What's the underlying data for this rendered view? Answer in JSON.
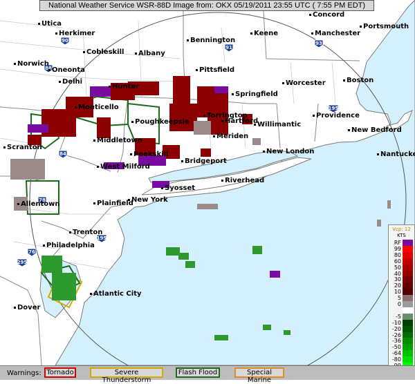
{
  "header": {
    "title": "National Weather Service WSR-88D Image from: OKX 05/19/2011 23:55 UTC ( 7:55 PM EDT)"
  },
  "cities": [
    {
      "name": "Utica",
      "dot": true
    },
    {
      "name": "Herkimer",
      "dot": true
    },
    {
      "name": "Bennington",
      "dot": true
    },
    {
      "name": "Keene",
      "dot": true
    },
    {
      "name": "Concord",
      "dot": true
    },
    {
      "name": "Manchester",
      "dot": true
    },
    {
      "name": "Portsmouth",
      "dot": true
    },
    {
      "name": "Cobleskill",
      "dot": true
    },
    {
      "name": "Albany",
      "dot": true
    },
    {
      "name": "Norwich",
      "dot": true
    },
    {
      "name": "Oneonta",
      "dot": true
    },
    {
      "name": "Delhi",
      "dot": true
    },
    {
      "name": "Pittsfield",
      "dot": true
    },
    {
      "name": "Worcester",
      "dot": true
    },
    {
      "name": "Boston",
      "dot": true
    },
    {
      "name": "Hunter",
      "dot": true
    },
    {
      "name": "Springfield",
      "dot": true
    },
    {
      "name": "Monticello",
      "dot": true
    },
    {
      "name": "Poughkeepsie",
      "dot": true
    },
    {
      "name": "Torrington",
      "dot": true
    },
    {
      "name": "Hartford",
      "dot": true
    },
    {
      "name": "Willimantic",
      "dot": true
    },
    {
      "name": "Providence",
      "dot": true
    },
    {
      "name": "New Bedford",
      "dot": true
    },
    {
      "name": "Scranton",
      "dot": true
    },
    {
      "name": "Middletown",
      "dot": true
    },
    {
      "name": "Meriden",
      "dot": true
    },
    {
      "name": "Nantucket",
      "dot": true
    },
    {
      "name": "Peekskill",
      "dot": true
    },
    {
      "name": "New London",
      "dot": true
    },
    {
      "name": "West Milford",
      "dot": true
    },
    {
      "name": "Bridgeport",
      "dot": true
    },
    {
      "name": "Riverhead",
      "dot": true
    },
    {
      "name": "Syosset",
      "dot": true
    },
    {
      "name": "Allentown",
      "dot": true
    },
    {
      "name": "Plainfield",
      "dot": true
    },
    {
      "name": "New York",
      "dot": true
    },
    {
      "name": "Trenton",
      "dot": true
    },
    {
      "name": "Philadelphia",
      "dot": true
    },
    {
      "name": "Atlantic City",
      "dot": true
    },
    {
      "name": "Dover",
      "dot": true
    }
  ],
  "highways": [
    "90",
    "88",
    "91",
    "95",
    "84",
    "87",
    "81",
    "78",
    "195",
    "76",
    "295",
    "495"
  ],
  "legend": {
    "vcp": "Vcp: 12",
    "units": "KTS",
    "entries": [
      {
        "label": "RF",
        "color": "#7a0ba0"
      },
      {
        "label": "99",
        "color": "#ff0000"
      },
      {
        "label": "80",
        "color": "#e00000"
      },
      {
        "label": "60",
        "color": "#c00000"
      },
      {
        "label": "50",
        "color": "#a80000"
      },
      {
        "label": "40",
        "color": "#900000"
      },
      {
        "label": "30",
        "color": "#780000"
      },
      {
        "label": "20",
        "color": "#640000"
      },
      {
        "label": "10",
        "color": "#500000"
      },
      {
        "label": "5",
        "color": "#8c6e6e"
      },
      {
        "label": "0",
        "color": "#9a9a9a"
      },
      {
        "label": "",
        "color": "#ffffff"
      },
      {
        "label": "-5",
        "color": "#6e8c6e"
      },
      {
        "label": "-10",
        "color": "#004000"
      },
      {
        "label": "-20",
        "color": "#005500"
      },
      {
        "label": "-26",
        "color": "#006e00"
      },
      {
        "label": "-36",
        "color": "#008a00"
      },
      {
        "label": "-50",
        "color": "#00a000"
      },
      {
        "label": "-64",
        "color": "#00c000"
      },
      {
        "label": "-80",
        "color": "#00e000"
      },
      {
        "label": "-99",
        "color": "#00ff00"
      },
      {
        "label": "ND",
        "color": "#f0f0f0"
      }
    ]
  },
  "warnings": {
    "label": "Warnings:",
    "items": [
      {
        "label": "Tornado",
        "color": "#cc0000"
      },
      {
        "label": "Severe Thunderstorm",
        "color": "#d4aa00"
      },
      {
        "label": "Flash Flood",
        "color": "#1a6a1a"
      },
      {
        "label": "Special Marine",
        "color": "#e08a2a"
      }
    ]
  },
  "colors": {
    "ocean": "#d4f0fc",
    "land": "#ffffff",
    "velocity_inbound": "#2e9a2e",
    "velocity_outbound": "#8b0000",
    "range_folding": "#7a0ba0"
  }
}
